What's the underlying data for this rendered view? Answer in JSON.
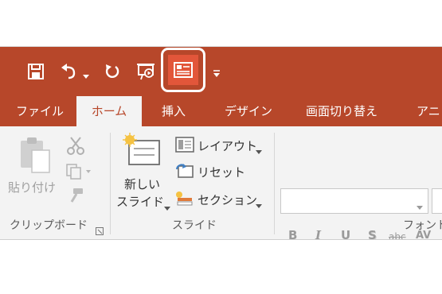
{
  "quick_access": {
    "save_icon": "save-icon",
    "undo_icon": "undo-icon",
    "redo_icon": "redo-icon",
    "slideshow_icon": "slideshow-from-beginning-icon",
    "new_slide_icon": "layout-icon",
    "customize_icon": "customize-qat-icon"
  },
  "tabs": [
    {
      "label": "ファイル"
    },
    {
      "label": "ホーム"
    },
    {
      "label": "挿入"
    },
    {
      "label": "デザイン"
    },
    {
      "label": "画面切り替え"
    },
    {
      "label": "アニ"
    }
  ],
  "clipboard": {
    "paste_label": "貼り付け",
    "group_label": "クリップボード"
  },
  "slides": {
    "new_slide_line1": "新しい",
    "new_slide_line2": "スライド",
    "layout_label": "レイアウト",
    "reset_label": "リセット",
    "section_label": "セクション",
    "group_label": "スライド"
  },
  "font": {
    "bold": "B",
    "italic": "I",
    "underline": "U",
    "shadow": "S",
    "strikethrough": "abc",
    "spacing": "AV",
    "group_label": "フォント"
  },
  "colors": {
    "accent": "#b7472a",
    "highlight_button": "#e2563a",
    "ribbon_bg": "#f3f3f3"
  }
}
